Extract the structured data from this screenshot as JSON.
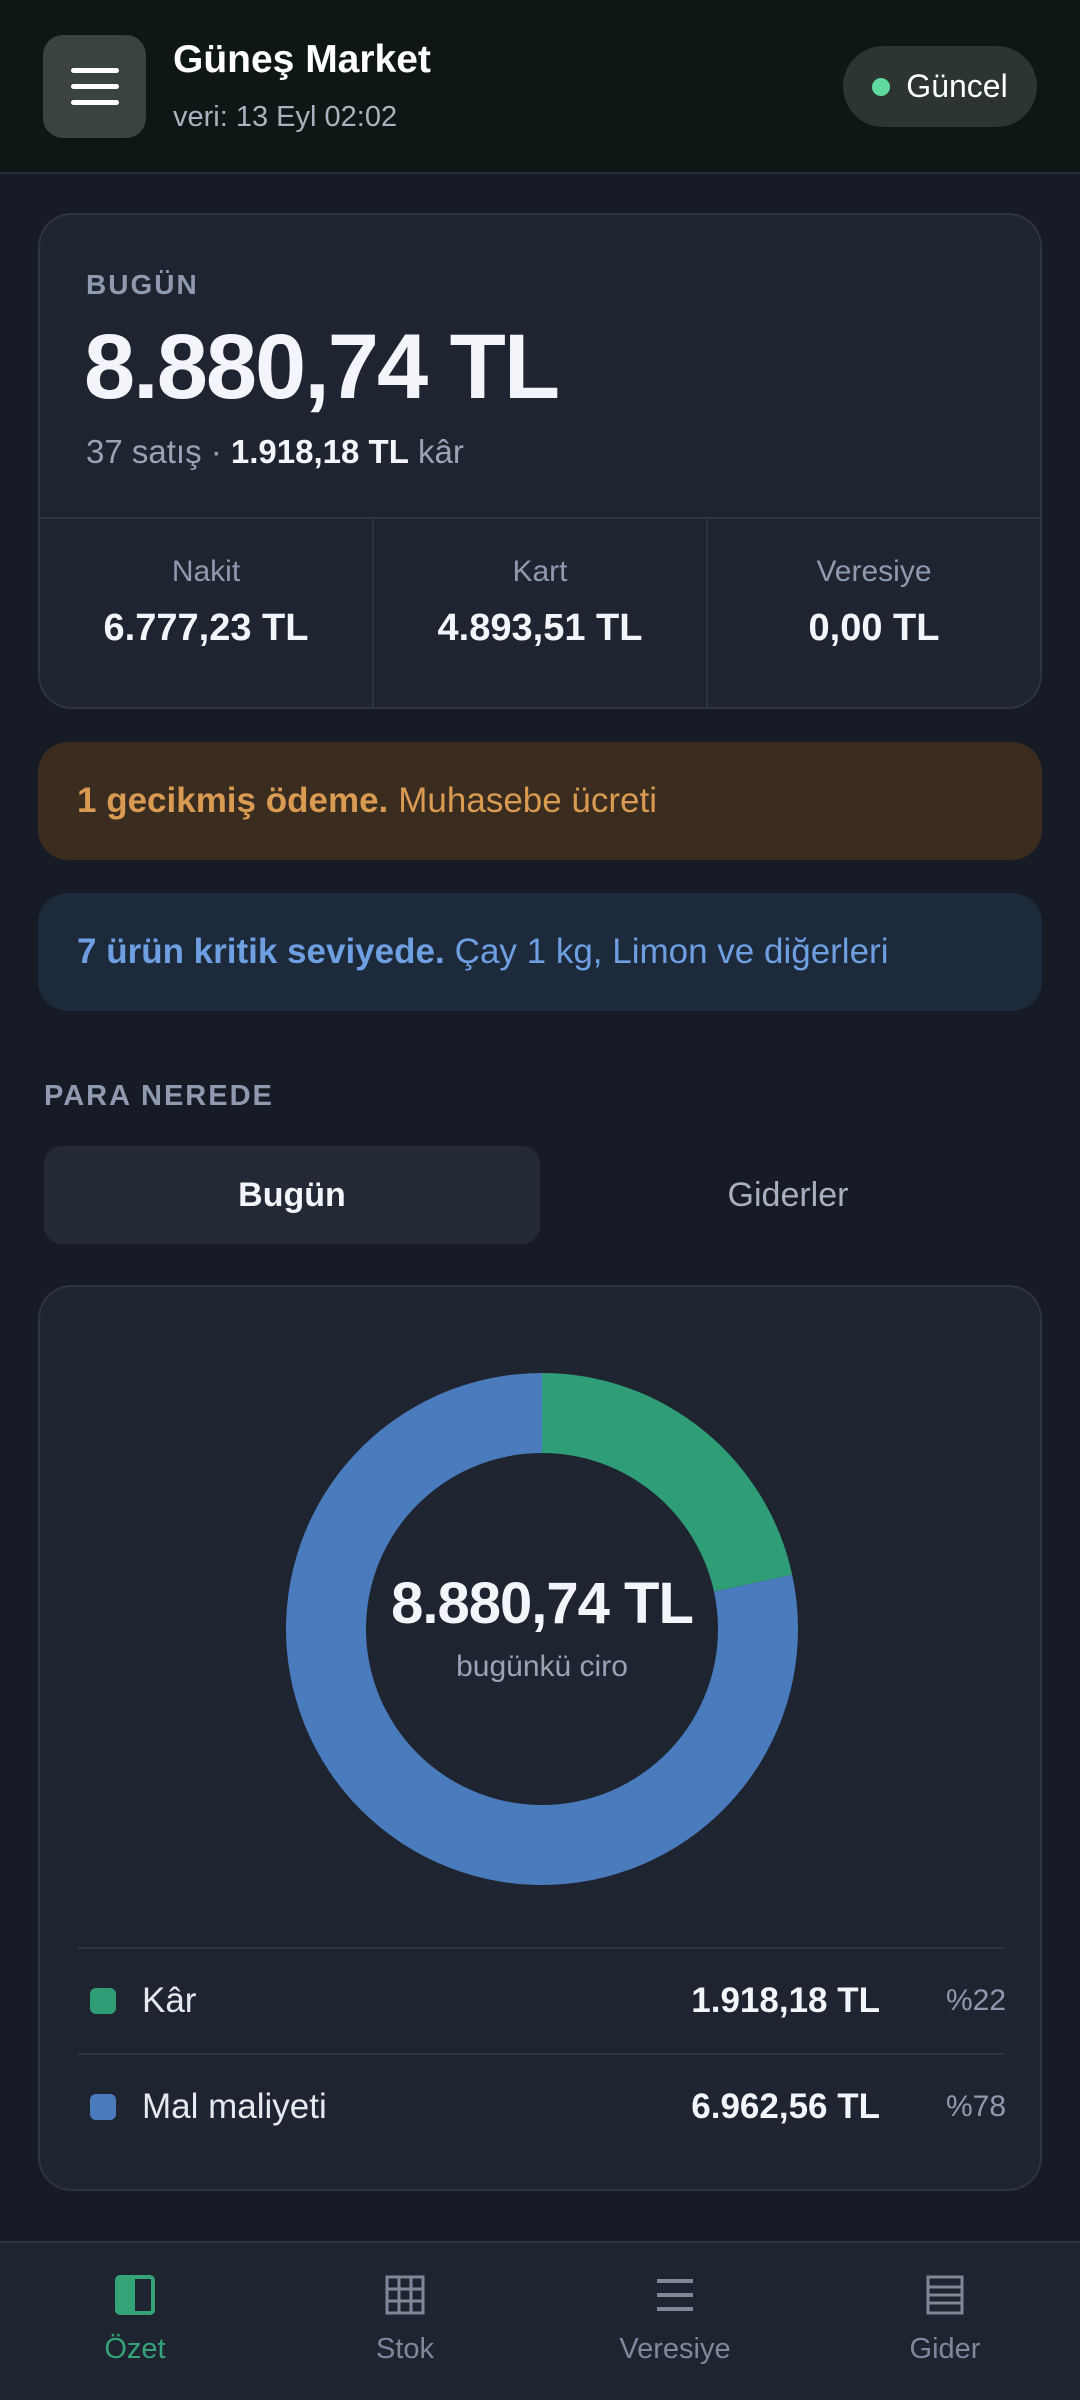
{
  "header": {
    "title": "Güneş Market",
    "subtitle": "veri: 13 Eyl 02:02",
    "status": {
      "label": "Güncel",
      "color": "#5fd99e"
    }
  },
  "today": {
    "label": "BUGÜN",
    "amount": "8.880,74 TL",
    "sales_count": "37 satış ·",
    "profit": "1.918,18 TL",
    "profit_suffix": "kâr",
    "split": [
      {
        "label": "Nakit",
        "value": "6.777,23 TL"
      },
      {
        "label": "Kart",
        "value": "4.893,51 TL"
      },
      {
        "label": "Veresiye",
        "value": "0,00 TL"
      }
    ]
  },
  "alerts": {
    "overdue": {
      "bold": "1 gecikmiş ödeme.",
      "text": "Muhasebe ücreti"
    },
    "stock": {
      "bold": "7 ürün kritik seviyede.",
      "text": "Çay 1 kg, Limon ve diğerleri"
    }
  },
  "section": {
    "label": "PARA NEREDE",
    "tabs": [
      {
        "label": "Bugün",
        "active": true
      },
      {
        "label": "Giderler",
        "active": false
      }
    ]
  },
  "chart_data": {
    "type": "pie",
    "center_value": "8.880,74 TL",
    "center_caption": "bugünkü ciro",
    "slices": [
      {
        "name": "Kâr",
        "value": 1918.18,
        "value_label": "1.918,18 TL",
        "percent_label": "%22",
        "color": "#2f9e76"
      },
      {
        "name": "Mal maliyeti",
        "value": 6962.56,
        "value_label": "6.962,56 TL",
        "percent_label": "%78",
        "color": "#4a7bbd"
      }
    ]
  },
  "nav": {
    "items": [
      {
        "label": "Özet",
        "icon": "summary-icon",
        "active": true
      },
      {
        "label": "Stok",
        "icon": "grid-icon",
        "active": false
      },
      {
        "label": "Veresiye",
        "icon": "list-icon",
        "active": false
      },
      {
        "label": "Gider",
        "icon": "ledger-icon",
        "active": false
      }
    ]
  }
}
